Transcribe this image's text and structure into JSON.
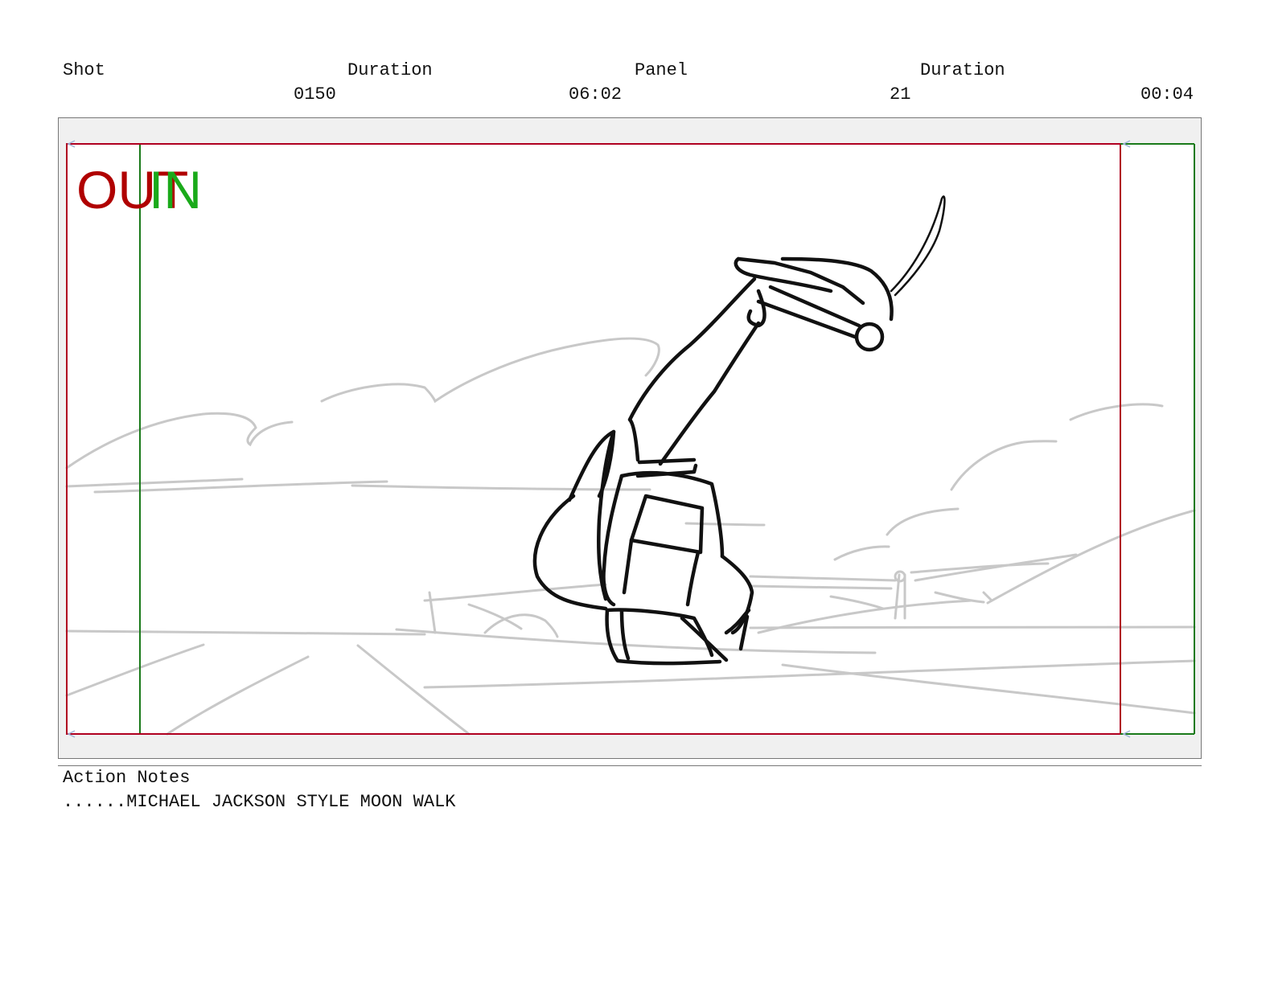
{
  "header": {
    "shot_label": "Shot",
    "shot_duration_label": "Duration",
    "panel_label": "Panel",
    "panel_duration_label": "Duration",
    "shot_number": "0150",
    "shot_duration": "06:02",
    "panel_number": "21",
    "panel_duration": "00:04"
  },
  "panel": {
    "out_label": "OUT",
    "in_label": "IN",
    "out_color": "#b00000",
    "in_color": "#1aaa1a"
  },
  "notes": {
    "label": "Action Notes",
    "text": "......MICHAEL JACKSON STYLE MOON WALK"
  }
}
